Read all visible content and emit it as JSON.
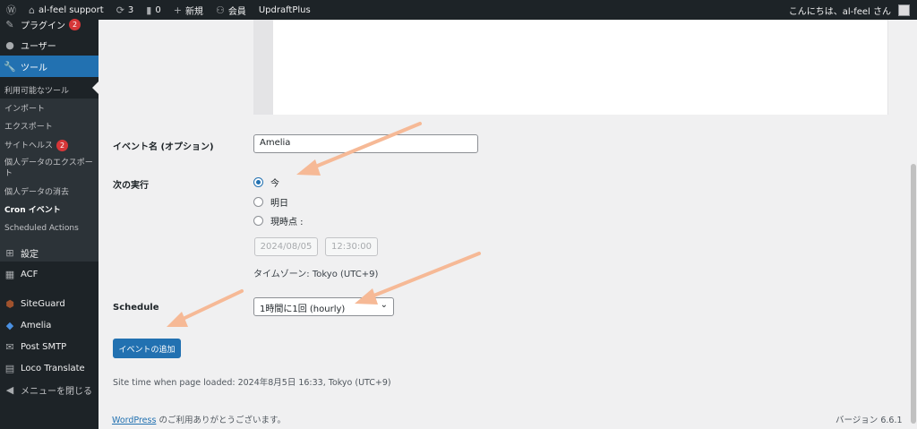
{
  "adminbar": {
    "site_name": "al-feel support",
    "updates_count": "3",
    "comments_count": "0",
    "new_label": "新規",
    "members_label": "会員",
    "plugin_label": "UpdraftPlus",
    "greeting": "こんにちは、al-feel さん"
  },
  "sidebar": {
    "plugins": {
      "label": "プラグイン",
      "badge": "2"
    },
    "users": {
      "label": "ユーザー"
    },
    "tools": {
      "label": "ツール"
    },
    "submenu": {
      "available_tools": "利用可能なツール",
      "import": "インポート",
      "export": "エクスポート",
      "site_health": "サイトヘルス",
      "site_health_badge": "2",
      "personal_export": "個人データのエクスポート",
      "personal_erase": "個人データの消去",
      "cron_events": "Cron イベント",
      "scheduled_actions": "Scheduled Actions"
    },
    "settings": {
      "label": "設定"
    },
    "acf": {
      "label": "ACF"
    },
    "siteguard": {
      "label": "SiteGuard"
    },
    "amelia": {
      "label": "Amelia"
    },
    "post_smtp": {
      "label": "Post SMTP"
    },
    "loco": {
      "label": "Loco Translate"
    },
    "collapse": {
      "label": "メニューを閉じる"
    }
  },
  "form": {
    "event_name_label": "イベント名 (オプション)",
    "event_name_value": "Amelia",
    "next_run_label": "次の実行",
    "next_run_options": [
      "今",
      "明日",
      "現時点 :"
    ],
    "next_run_selected": "今",
    "date_year": "2024",
    "date_month": "08",
    "date_day": "05",
    "time_hour": "12",
    "time_minute": "30",
    "time_second": "00",
    "timezone_text": "タイムゾーン: Tokyo (UTC+9)",
    "schedule_label": "Schedule",
    "schedule_value": "1時間に1回 (hourly)",
    "add_button": "イベントの追加"
  },
  "site_time": "Site time when page loaded: 2024年8月5日 16:33, Tokyo (UTC+9)",
  "footer": {
    "wp_link": "WordPress",
    "thanks": " のご利用ありがとうございます。",
    "version": "バージョン 6.6.1"
  },
  "colors": {
    "accent": "#2271b1",
    "adminbar": "#1d2327",
    "badge": "#d63638",
    "annotation_arrow": "#f6b996"
  }
}
